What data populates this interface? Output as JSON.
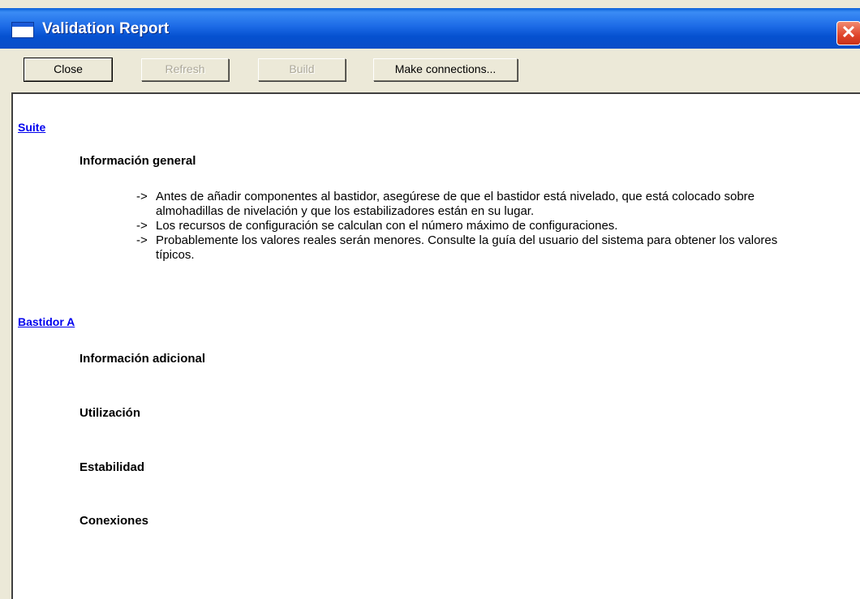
{
  "window": {
    "title": "Validation Report",
    "close_glyph": "✕"
  },
  "toolbar": {
    "close_label": "Close",
    "refresh_label": "Refresh",
    "build_label": "Build",
    "connections_label": "Make connections..."
  },
  "report": {
    "sections": [
      {
        "link": "Suite",
        "headings": [
          "Información general"
        ],
        "notes": [
          "Antes de añadir componentes al bastidor, asegúrese de que el bastidor está nivelado, que está colocado sobre almohadillas de nivelación y que los estabilizadores están en su lugar.",
          "Los recursos de configuración se calculan con el número máximo de configuraciones.",
          "Probablemente los valores reales serán menores. Consulte la guía del usuario del sistema para obtener los valores típicos."
        ],
        "note_prefix": "->"
      },
      {
        "link": "Bastidor A",
        "headings": [
          "Información adicional",
          "Utilización",
          "Estabilidad",
          "Conexiones"
        ]
      }
    ]
  }
}
